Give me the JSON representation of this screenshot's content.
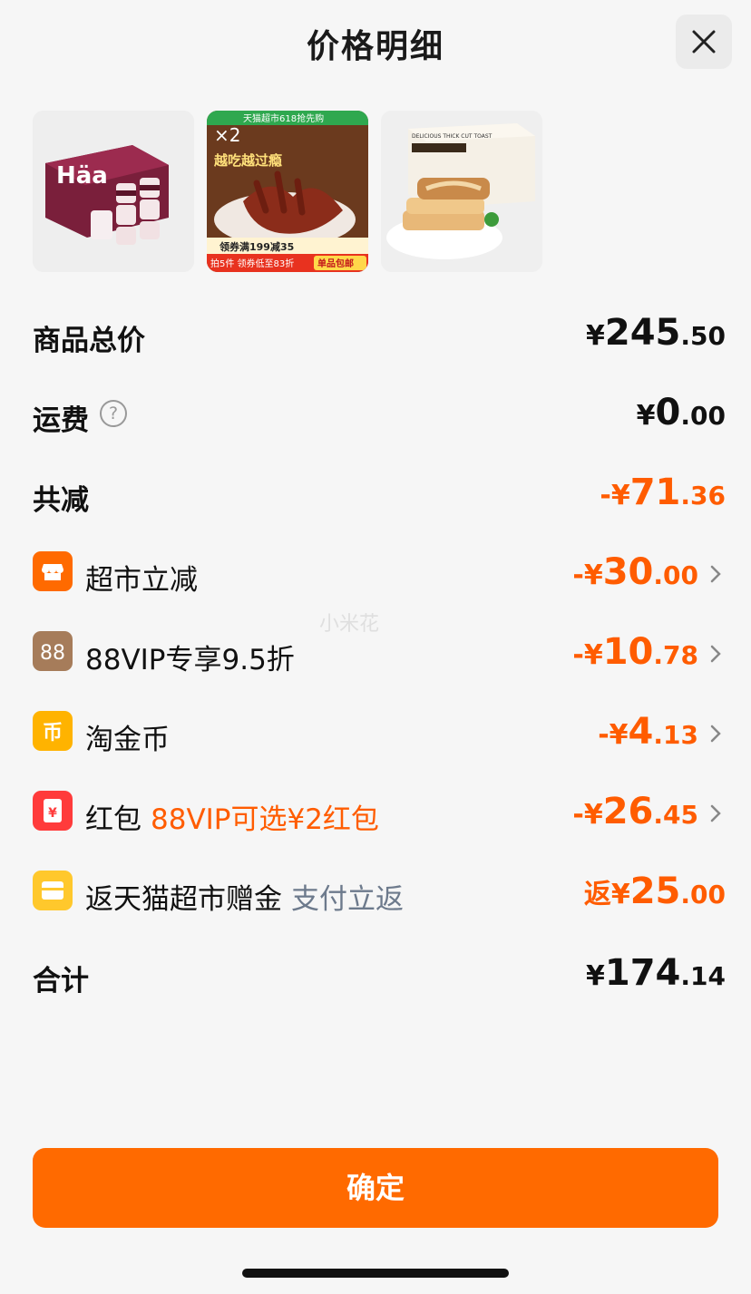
{
  "header": {
    "title": "价格明细",
    "close_icon": "close-icon"
  },
  "products": [
    {
      "name": "Häagen-Dazs ice cream box",
      "brand_text": "Häa"
    },
    {
      "name": "chicken feet snack",
      "badge": "×2",
      "banner_top": "天猫超市618抢先购",
      "headline": "越吃越过瘾",
      "coupon": "领券满199减35",
      "promo": "拍5件 领券低至83折",
      "tag": "单品包邮"
    },
    {
      "name": "thick cut toast",
      "box_text": "DELICIOUS THICK CUT TOAST"
    }
  ],
  "summary": {
    "subtotal": {
      "label": "商品总价",
      "symbol": "¥",
      "int": "245",
      "dec": ".50"
    },
    "shipping": {
      "label": "运费",
      "symbol": "¥",
      "int": "0",
      "dec": ".00"
    },
    "total_discount": {
      "label": "共减",
      "symbol": "-¥",
      "int": "71",
      "dec": ".36"
    }
  },
  "discounts": [
    {
      "icon": "store-icon",
      "color": "#ff6a00",
      "label": "超市立减",
      "extra": "",
      "symbol": "-¥",
      "int": "30",
      "dec": ".00"
    },
    {
      "icon": "vip88-icon",
      "color": "#b08a6a",
      "label": "88VIP专享9.5折",
      "extra": "",
      "symbol": "-¥",
      "int": "10",
      "dec": ".78"
    },
    {
      "icon": "coin-icon",
      "color": "#ffb300",
      "label": "淘金币",
      "extra": "",
      "symbol": "-¥",
      "int": "4",
      "dec": ".13"
    },
    {
      "icon": "red-packet-icon",
      "color": "#ff3b3b",
      "label": "红包",
      "extra": "88VIP可选¥2红包",
      "symbol": "-¥",
      "int": "26",
      "dec": ".45"
    },
    {
      "icon": "gift-icon",
      "color": "#ffc82c",
      "label": "返天猫超市赠金",
      "extra": "支付立返",
      "symbol": "返¥",
      "int": "25",
      "dec": ".00"
    }
  ],
  "total": {
    "label": "合计",
    "symbol": "¥",
    "int": "174",
    "dec": ".14"
  },
  "watermark": "小米花",
  "confirm_label": "确定"
}
